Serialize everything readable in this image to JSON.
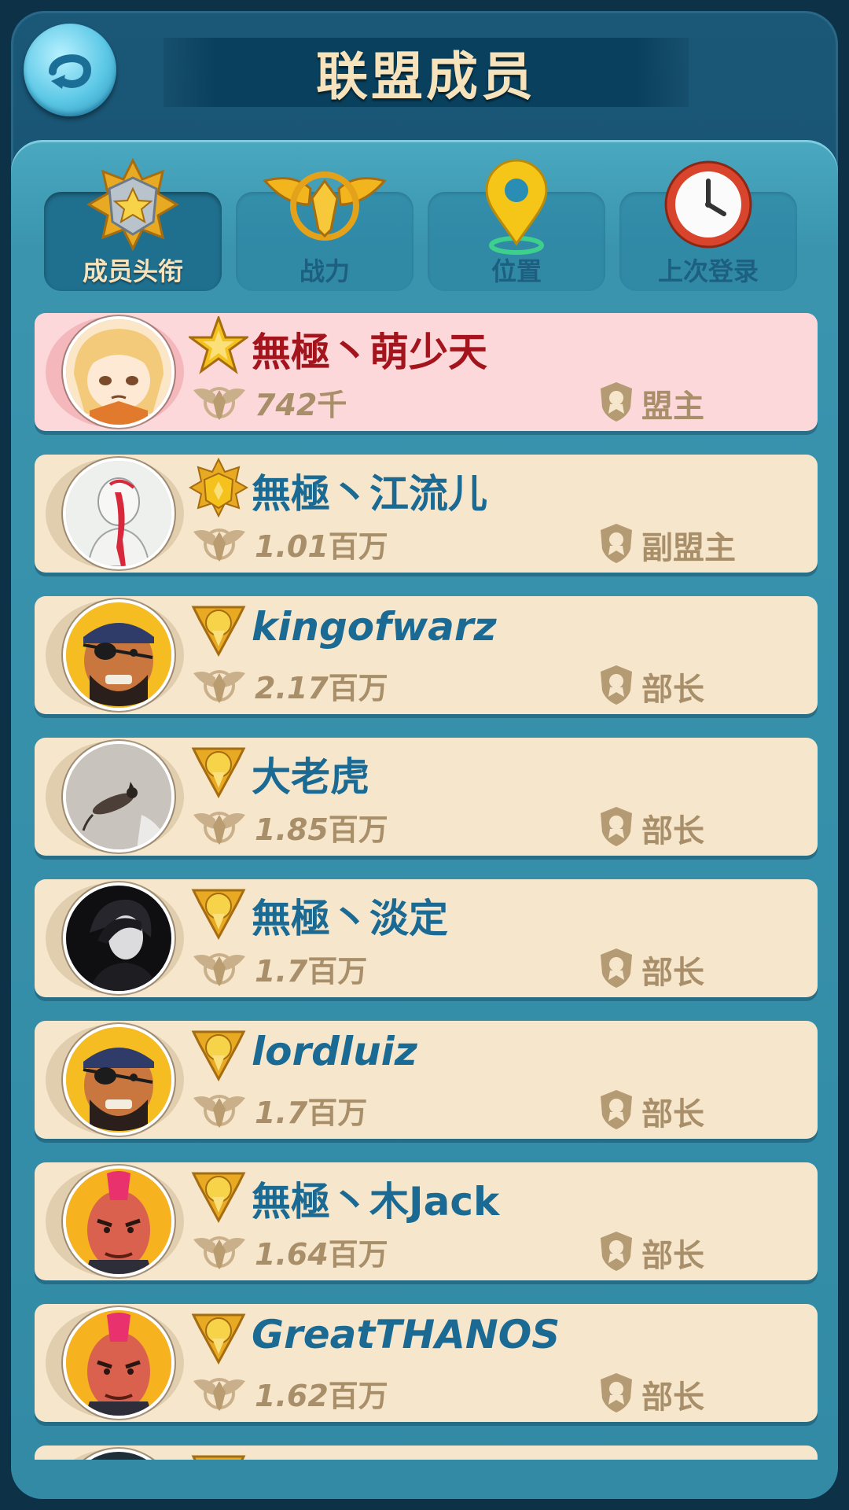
{
  "header": {
    "title": "联盟成员"
  },
  "tabs": [
    {
      "label": "成员头衔",
      "icon": "rank-star-icon",
      "active": true
    },
    {
      "label": "战力",
      "icon": "eagle-emblem-icon",
      "active": false
    },
    {
      "label": "位置",
      "icon": "location-pin-icon",
      "active": false
    },
    {
      "label": "上次登录",
      "icon": "clock-icon",
      "active": false
    }
  ],
  "members": [
    {
      "name": "無極丶萌少天",
      "power_value": "742",
      "power_unit": "千",
      "role": "盟主",
      "rank_icon": "leader-star-icon",
      "avatar": "anime-girl-avatar",
      "highlight": true
    },
    {
      "name": "無極丶江流儿",
      "power_value": "1.01",
      "power_unit": "百万",
      "role": "副盟主",
      "rank_icon": "vice-leader-badge-icon",
      "avatar": "sketch-avatar",
      "highlight": false
    },
    {
      "name": "kingofwarz",
      "power_value": "2.17",
      "power_unit": "百万",
      "role": "部长",
      "rank_icon": "officer-badge-icon",
      "avatar": "pirate-avatar",
      "highlight": false
    },
    {
      "name": "大老虎",
      "power_value": "1.85",
      "power_unit": "百万",
      "role": "部长",
      "rank_icon": "officer-badge-icon",
      "avatar": "cat-photo-avatar",
      "highlight": false
    },
    {
      "name": "無極丶淡定",
      "power_value": "1.7",
      "power_unit": "百万",
      "role": "部长",
      "rank_icon": "officer-badge-icon",
      "avatar": "dark-anime-avatar",
      "highlight": false
    },
    {
      "name": "lordluiz",
      "power_value": "1.7",
      "power_unit": "百万",
      "role": "部长",
      "rank_icon": "officer-badge-icon",
      "avatar": "pirate-avatar",
      "highlight": false
    },
    {
      "name": "無極丶木Jack",
      "power_value": "1.64",
      "power_unit": "百万",
      "role": "部长",
      "rank_icon": "officer-badge-icon",
      "avatar": "mohawk-avatar",
      "highlight": false
    },
    {
      "name": "GreatTHANOS",
      "power_value": "1.62",
      "power_unit": "百万",
      "role": "部长",
      "rank_icon": "officer-badge-icon",
      "avatar": "mohawk-avatar",
      "highlight": false
    }
  ],
  "colors": {
    "background": "#0d3147",
    "panel": "#3a94ae",
    "row": "#f6e7cc",
    "row_highlight": "#fdd8da",
    "name": "#1b6a93",
    "name_highlight": "#a3141c",
    "muted": "#a88f6a",
    "gold": "#f2b51d"
  }
}
